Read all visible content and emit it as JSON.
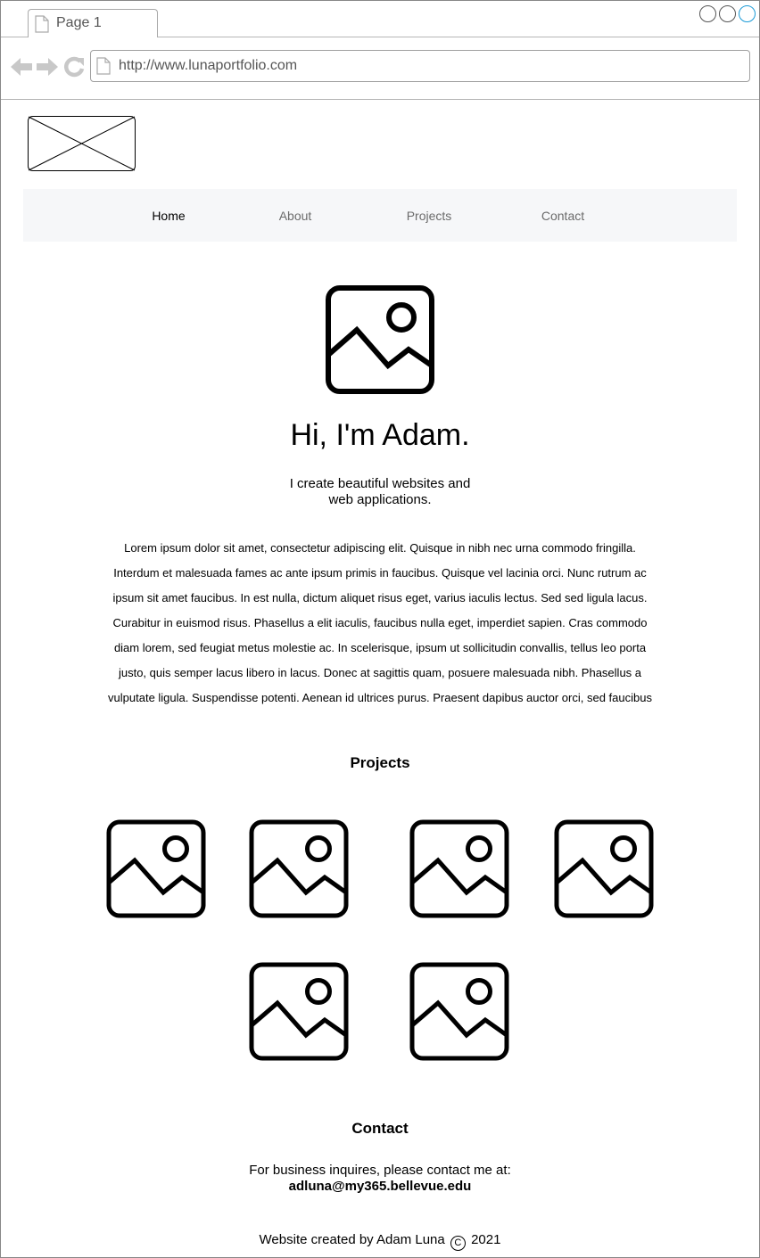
{
  "browser": {
    "tab_label": "Page 1",
    "url": "http://www.lunaportfolio.com",
    "icons": [
      "back-arrow-icon",
      "forward-arrow-icon",
      "reload-icon",
      "page-icon"
    ]
  },
  "nav": {
    "items": [
      {
        "label": "Home",
        "active": true
      },
      {
        "label": "About",
        "active": false
      },
      {
        "label": "Projects",
        "active": false
      },
      {
        "label": "Contact",
        "active": false
      }
    ]
  },
  "hero": {
    "title": "Hi, I'm Adam.",
    "subtitle_line1": "I create beautiful websites and",
    "subtitle_line2": "web applications."
  },
  "intro": {
    "lines": [
      "Lorem ipsum dolor sit amet, consectetur adipiscing elit. Quisque in nibh nec urna commodo fringilla.",
      "Interdum et malesuada fames ac ante ipsum primis in faucibus. Quisque vel lacinia orci. Nunc rutrum ac",
      "ipsum sit amet faucibus. In est nulla, dictum aliquet risus eget, varius iaculis lectus. Sed sed ligula lacus.",
      "Curabitur in euismod risus. Phasellus a elit iaculis, faucibus nulla eget, imperdiet sapien. Cras commodo",
      "diam lorem, sed feugiat metus molestie ac. In scelerisque, ipsum ut sollicitudin convallis, tellus leo porta",
      "justo, quis semper lacus libero in lacus. Donec at sagittis quam, posuere malesuada nibh. Phasellus a",
      "vulputate ligula. Suspendisse potenti. Aenean id ultrices purus. Praesent dapibus auctor orci, sed faucibus"
    ]
  },
  "projects": {
    "title": "Projects"
  },
  "contact": {
    "title": "Contact",
    "text": "For business inquires, please contact me at:",
    "email": "adluna@my365.bellevue.edu"
  },
  "footer": {
    "prefix": "Website created by Adam Luna",
    "copyright_symbol": "C",
    "year": "2021"
  },
  "colors": {
    "window_control_active": "#1a9ad6",
    "navbar_bg": "#f6f7f9",
    "chrome_gray": "#c8c8c8"
  }
}
